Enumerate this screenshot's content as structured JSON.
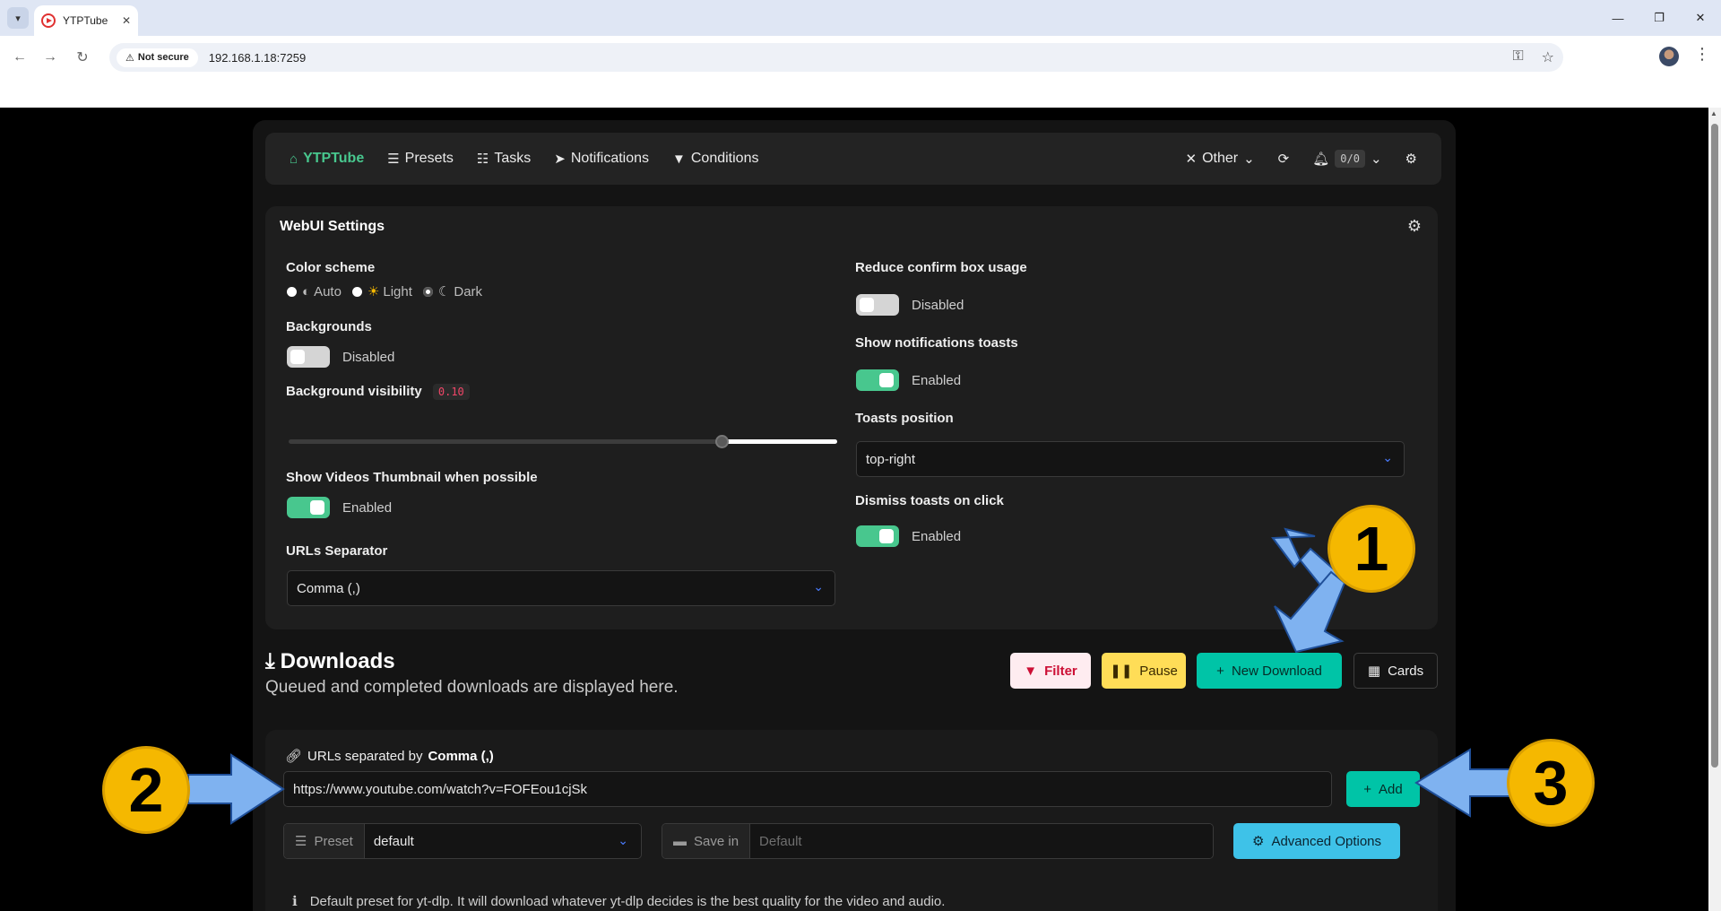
{
  "browser": {
    "tab_title": "YTPTube",
    "tab_close": "✕",
    "security_label": "Not secure",
    "url": "192.168.1.18:7259"
  },
  "navbar": {
    "brand": "YTPTube",
    "items": [
      {
        "label": "Presets",
        "icon": "sliders-icon"
      },
      {
        "label": "Tasks",
        "icon": "tasks-icon"
      },
      {
        "label": "Notifications",
        "icon": "paper-plane-icon"
      },
      {
        "label": "Conditions",
        "icon": "filter-icon"
      }
    ],
    "other_label": "Other",
    "counter": "0/0"
  },
  "settings": {
    "title": "WebUI Settings",
    "color_scheme": {
      "label": "Color scheme",
      "options": [
        "Auto",
        "Light",
        "Dark"
      ],
      "selected": "Dark"
    },
    "backgrounds": {
      "label": "Backgrounds",
      "state": "Disabled"
    },
    "bg_visibility": {
      "label": "Background visibility",
      "value": "0.10",
      "level": 0.79
    },
    "thumbnail": {
      "label": "Show Videos Thumbnail when possible",
      "state": "Enabled"
    },
    "separator": {
      "label": "URLs Separator",
      "value": "Comma (,)"
    },
    "reduce_confirm": {
      "label": "Reduce confirm box usage",
      "state": "Disabled"
    },
    "notif_toasts": {
      "label": "Show notifications toasts",
      "state": "Enabled"
    },
    "toasts_position": {
      "label": "Toasts position",
      "value": "top-right"
    },
    "dismiss_toasts": {
      "label": "Dismiss toasts on click",
      "state": "Enabled"
    }
  },
  "downloads": {
    "title": "Downloads",
    "subtitle": "Queued and completed downloads are displayed here.",
    "buttons": {
      "filter": "Filter",
      "pause": "Pause",
      "new": "New Download",
      "cards": "Cards"
    }
  },
  "add_form": {
    "label_prefix": "URLs separated by",
    "label_sep": "Comma (,)",
    "url_value": "https://www.youtube.com/watch?v=FOFEou1cjSk",
    "add_button": "Add",
    "preset_label": "Preset",
    "preset_value": "default",
    "save_in_label": "Save in",
    "save_in_placeholder": "Default",
    "advanced": "Advanced Options",
    "help": "Default preset for yt-dlp. It will download whatever yt-dlp decides is the best quality for the video and audio."
  },
  "annotations": [
    "1",
    "2",
    "3"
  ],
  "colors": {
    "accent_green": "#48c78e",
    "teal": "#00c4a7",
    "warning": "#ffdd57",
    "info": "#3ec2e8",
    "badge": "#f5b800",
    "arrow": "#7fb2f0"
  }
}
